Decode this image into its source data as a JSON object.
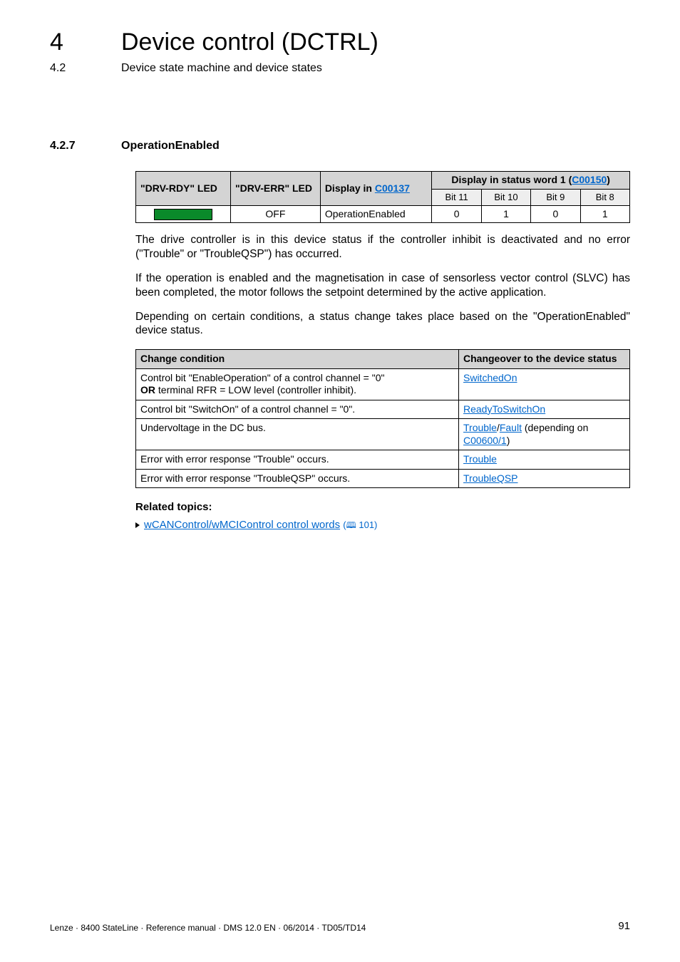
{
  "header": {
    "chapter_number": "4",
    "chapter_title": "Device control (DCTRL)",
    "sub_number": "4.2",
    "sub_title": "Device state machine and device states"
  },
  "section": {
    "number": "4.2.7",
    "title": "OperationEnabled"
  },
  "dashline": "_ _ _ _ _ _ _ _ _ _ _ _ _ _ _ _ _ _ _ _ _ _ _ _ _ _ _ _ _ _ _ _ _ _ _ _ _ _ _ _ _ _ _ _ _ _ _ _ _ _ _ _ _ _ _ _ _ _ _ _ _ _ _ _",
  "status_table": {
    "headers": {
      "col1": "\"DRV-RDY\" LED",
      "col2": "\"DRV-ERR\" LED",
      "col3_prefix": "Display in ",
      "col3_link": "C00137",
      "col4_prefix": "Display in status word 1 (",
      "col4_link": "C00150",
      "col4_suffix": ")"
    },
    "subheaders": {
      "b11": "Bit 11",
      "b10": "Bit 10",
      "b9": "Bit 9",
      "b8": "Bit 8"
    },
    "row": {
      "drv_err": "OFF",
      "display": "OperationEnabled",
      "b11": "0",
      "b10": "1",
      "b9": "0",
      "b8": "1"
    }
  },
  "paragraphs": {
    "p1": "The drive controller is in this device status if the controller inhibit is deactivated and no error (\"Trouble\" or \"TroubleQSP\") has occurred.",
    "p2": "If the operation is enabled and the magnetisation in case of sensorless vector control (SLVC) has been completed, the motor follows the setpoint determined by the active application.",
    "p3": "Depending on certain conditions, a status change takes place based on the \"OperationEnabled\" device status."
  },
  "changes_table": {
    "headers": {
      "col1": "Change condition",
      "col2": "Changeover to the device status"
    },
    "rows": [
      {
        "cond_parts": {
          "a": "Control bit \"EnableOperation\" of a control channel = \"0\"",
          "b_bold": "OR",
          "b_rest": " terminal RFR = LOW level (controller inhibit)."
        },
        "result_link": "SwitchedOn"
      },
      {
        "cond": "Control bit \"SwitchOn\" of a control channel = \"0\".",
        "result_link": "ReadyToSwitchOn"
      },
      {
        "cond": "Undervoltage in the DC bus.",
        "result_links": {
          "a": "Trouble",
          "sep1": "/",
          "b": "Fault",
          "mid": " (depending on ",
          "c": "C00600/1",
          "end": ")"
        }
      },
      {
        "cond": "Error with error response \"Trouble\" occurs.",
        "result_link": "Trouble"
      },
      {
        "cond": "Error with error response \"TroubleQSP\" occurs.",
        "result_link": "TroubleQSP"
      }
    ]
  },
  "related": {
    "heading": "Related topics:",
    "link_text": "wCANControl/wMCIControl control words",
    "ref": " 101)"
  },
  "footer": {
    "text": "Lenze · 8400 StateLine · Reference manual · DMS 12.0 EN · 06/2014 · TD05/TD14",
    "page": "91"
  }
}
